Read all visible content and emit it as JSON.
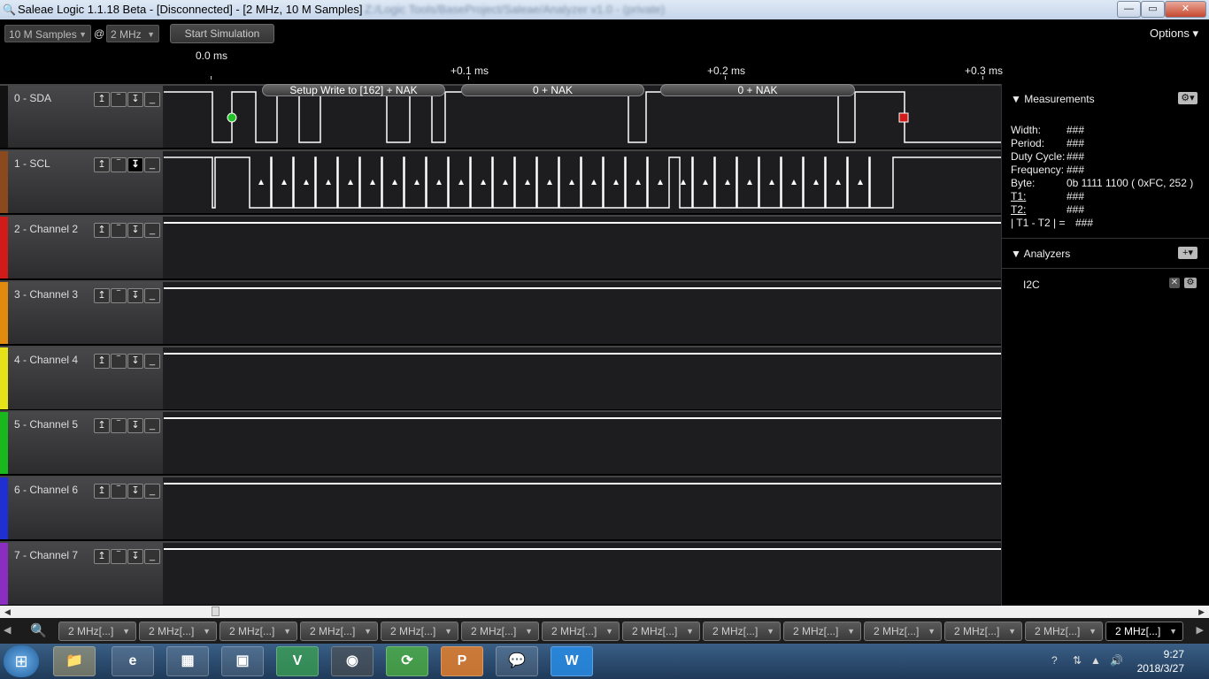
{
  "window": {
    "title": "Saleae Logic 1.1.18 Beta - [Disconnected] - [2 MHz, 10 M Samples]",
    "blurred_title_extra": "Z:/Logic Tools/BaseProject/Saleae/Analyzer v1.0 - (private)",
    "minimize": "—",
    "restore": "▭",
    "close": "✕"
  },
  "toolbar": {
    "samples": "10 M Samples",
    "at": "@",
    "rate": "2 MHz",
    "start_simulation": "Start Simulation",
    "options": "Options ▾"
  },
  "ruler": {
    "t0": "0.0 ms",
    "t1": "+0.1 ms",
    "t2": "+0.2 ms",
    "t3": "+0.3 ms"
  },
  "channels": [
    {
      "name": "0 - SDA",
      "color": "#111111"
    },
    {
      "name": "1 - SCL",
      "color": "#8a4a1e"
    },
    {
      "name": "2 - Channel 2",
      "color": "#d11a1a"
    },
    {
      "name": "3 - Channel 3",
      "color": "#e08a10"
    },
    {
      "name": "4 - Channel 4",
      "color": "#e6e21a"
    },
    {
      "name": "5 - Channel 5",
      "color": "#19b81c"
    },
    {
      "name": "6 - Channel 6",
      "color": "#1f2fd1"
    },
    {
      "name": "7 - Channel 7",
      "color": "#8a2dc1"
    }
  ],
  "decode": {
    "b1": "Setup Write to [162] + NAK",
    "b2": "0 + NAK",
    "b3": "0 + NAK"
  },
  "measurements": {
    "title": "Measurements",
    "width_label": "Width:",
    "width_value": "###",
    "period_label": "Period:",
    "period_value": "###",
    "duty_label": "Duty Cycle:",
    "duty_value": "###",
    "freq_label": "Frequency:",
    "freq_value": "###",
    "byte_label": "Byte:",
    "byte_value": "0b  1111  1100 ( 0xFC, 252 )",
    "t1_label": "T1:",
    "t1_value": "###",
    "t2_label": "T2:",
    "t2_value": "###",
    "diff_label": "| T1 - T2 | =",
    "diff_value": "###"
  },
  "analyzers": {
    "title": "Analyzers",
    "add": "+▾",
    "items": [
      {
        "name": "I2C"
      }
    ]
  },
  "tabs": {
    "label": "2 MHz[...]",
    "count_visible": 14
  },
  "taskbar": {
    "time": "9:27",
    "date": "2018/3/27"
  }
}
